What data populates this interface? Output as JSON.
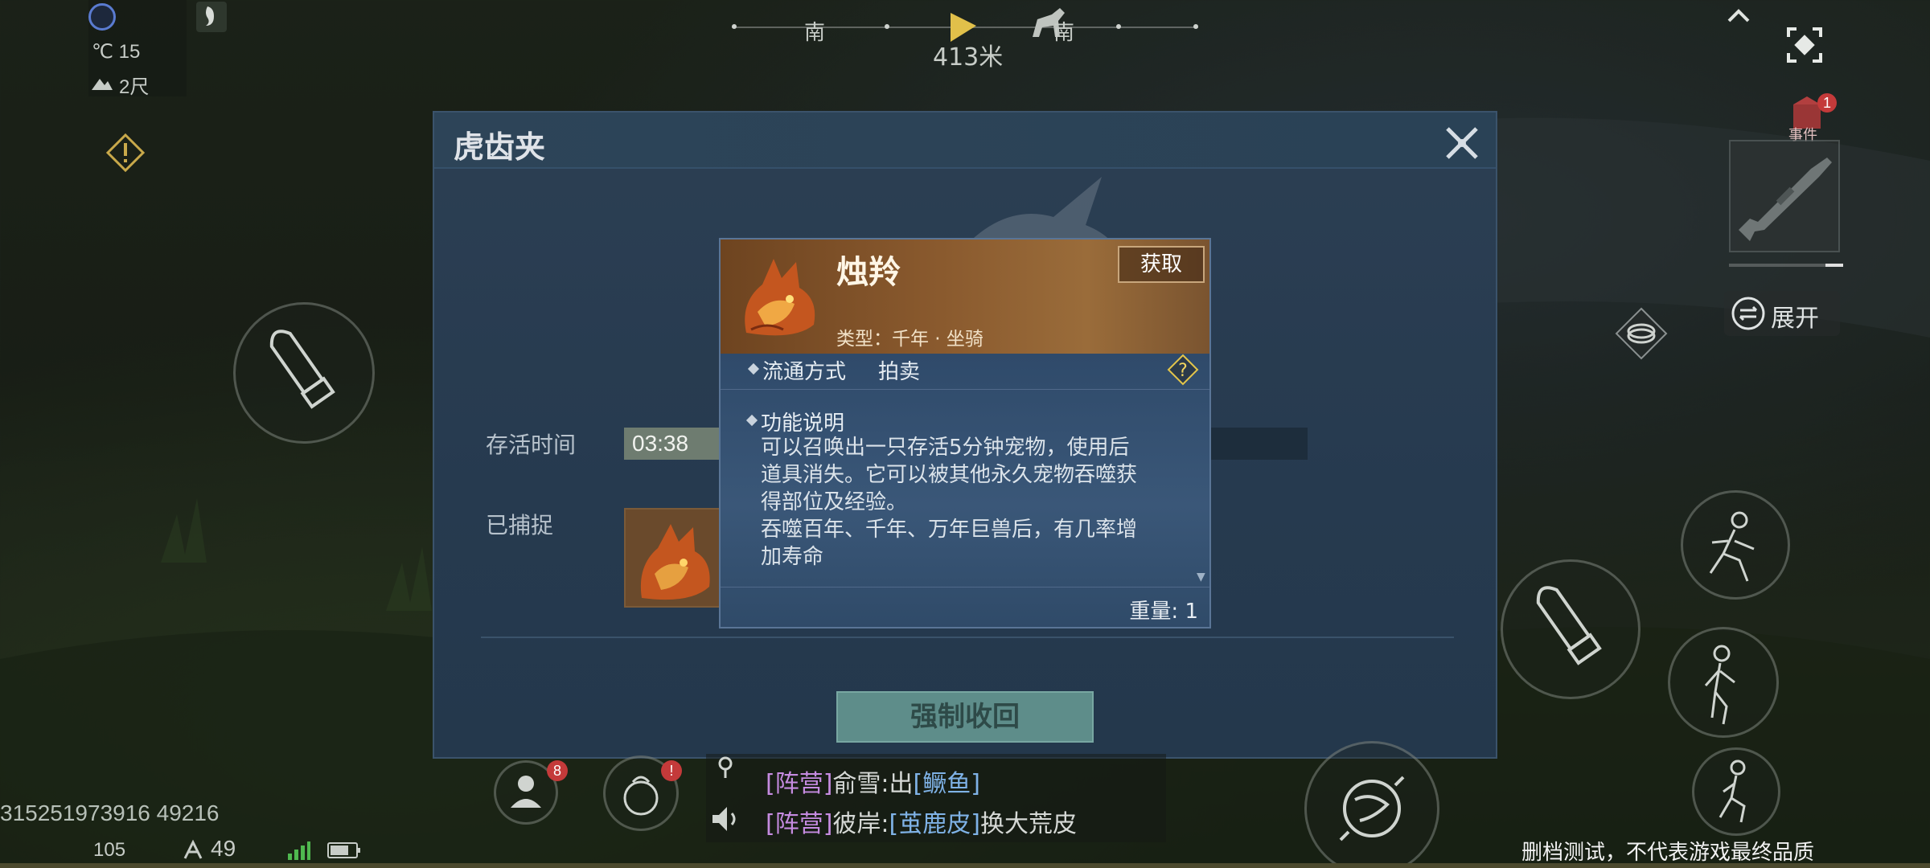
{
  "hud": {
    "temperature": "℃ 15",
    "distance_small": "2尺",
    "compass": {
      "left_dir": "南",
      "right_dir": "南",
      "distance": "413米"
    }
  },
  "dialog": {
    "title": "虎齿夹",
    "survival_label": "存活时间",
    "survival_time": "03:38",
    "captured_label": "已捕捉",
    "force_button": "强制收回"
  },
  "popup": {
    "name": "烛羚",
    "get_button": "获取",
    "type_text": "类型：千年 · 坐骑",
    "circulation_label": "流通方式",
    "circulation_value": "拍卖",
    "function_title": "功能说明",
    "function_lines": [
      "可以召唤出一只存活5分钟宠物，使用后",
      "道具消失。它可以被其他永久宠物吞噬获",
      "得部位及经验。",
      "吞噬百年、千年、万年巨兽后，有几率增",
      "加寿命"
    ],
    "weight": "重量: 1"
  },
  "right_panel": {
    "expand_label": "展开",
    "event_badge": "1",
    "event_label": "事件"
  },
  "bottom_bar": {
    "bag_badge": "8",
    "alert_badge": "!",
    "player_id": "315251973916 49216",
    "level": "105",
    "ping": "49"
  },
  "chat": {
    "line1": {
      "tag": "[阵营]",
      "name": "俞雪:出",
      "item": "[鳜鱼]",
      "suffix": ""
    },
    "line2": {
      "tag": "[阵营]",
      "name": "彼岸:",
      "item": "[茧鹿皮]",
      "suffix": "换大荒皮"
    }
  },
  "disclaimer": "删档测试，不代表游戏最终品质",
  "colors": {
    "accent_gold": "#c8a67c",
    "dialog_bg": "#263a4f",
    "badge_red": "#c43a3a"
  }
}
